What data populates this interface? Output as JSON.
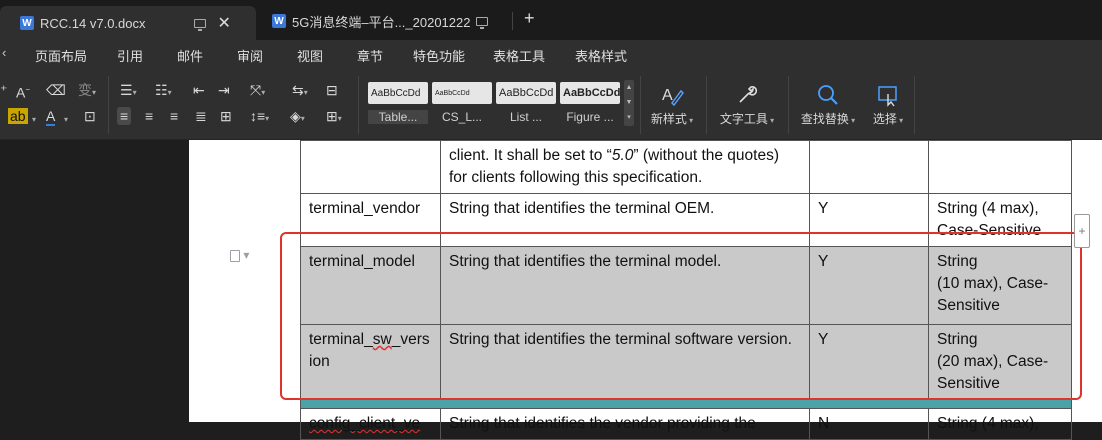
{
  "tabs": [
    {
      "title": "RCC.14 v7.0.docx",
      "icon": "word-doc-icon",
      "active": true
    },
    {
      "title": "5G消息终端–平台..._20201222",
      "icon": "word-doc-icon",
      "active": false
    }
  ],
  "menu": [
    "页面布局",
    "引用",
    "邮件",
    "审阅",
    "视图",
    "章节",
    "特色功能",
    "表格工具",
    "表格样式"
  ],
  "styles": [
    {
      "sample": "AaBbCcDd",
      "name": "Table..."
    },
    {
      "sample": "AaBbCcDd",
      "name": "CS_L..."
    },
    {
      "sample": "AaBbCcDd",
      "name": "List ..."
    },
    {
      "sample": "AaBbCcDd",
      "name": "Figure ..."
    }
  ],
  "tools": {
    "new_style": "新样式",
    "text_tools": "文字工具",
    "find_replace": "查找替换",
    "select": "选择"
  },
  "table": {
    "rows": [
      {
        "c1": "",
        "c2": "client. It shall be set to “5.0” (without the quotes) for clients following this specification.",
        "c3": "",
        "c4": ""
      },
      {
        "c1": "terminal_vendor",
        "c2": "String that identifies the terminal OEM.",
        "c3": "Y",
        "c4": "String (4 max), Case-Sensitive"
      },
      {
        "c1": "terminal_model",
        "c2": "String that identifies the terminal model.",
        "c3": "Y",
        "c4": "String\n(10 max), Case-Sensitive"
      },
      {
        "c1": "terminal_sw_version",
        "c2": "String that identifies the terminal software version.",
        "c3": "Y",
        "c4": "String\n(20 max), Case-Sensitive"
      },
      {
        "c1": "config_client_ve",
        "c2": "String that identifies the vendor providing the",
        "c3": "N",
        "c4": "String (4 max),"
      }
    ]
  },
  "colors": {
    "highlight_row": "#c9c9c9",
    "annotation_border": "#e0332c",
    "selection_line": "#4aa3a8"
  }
}
